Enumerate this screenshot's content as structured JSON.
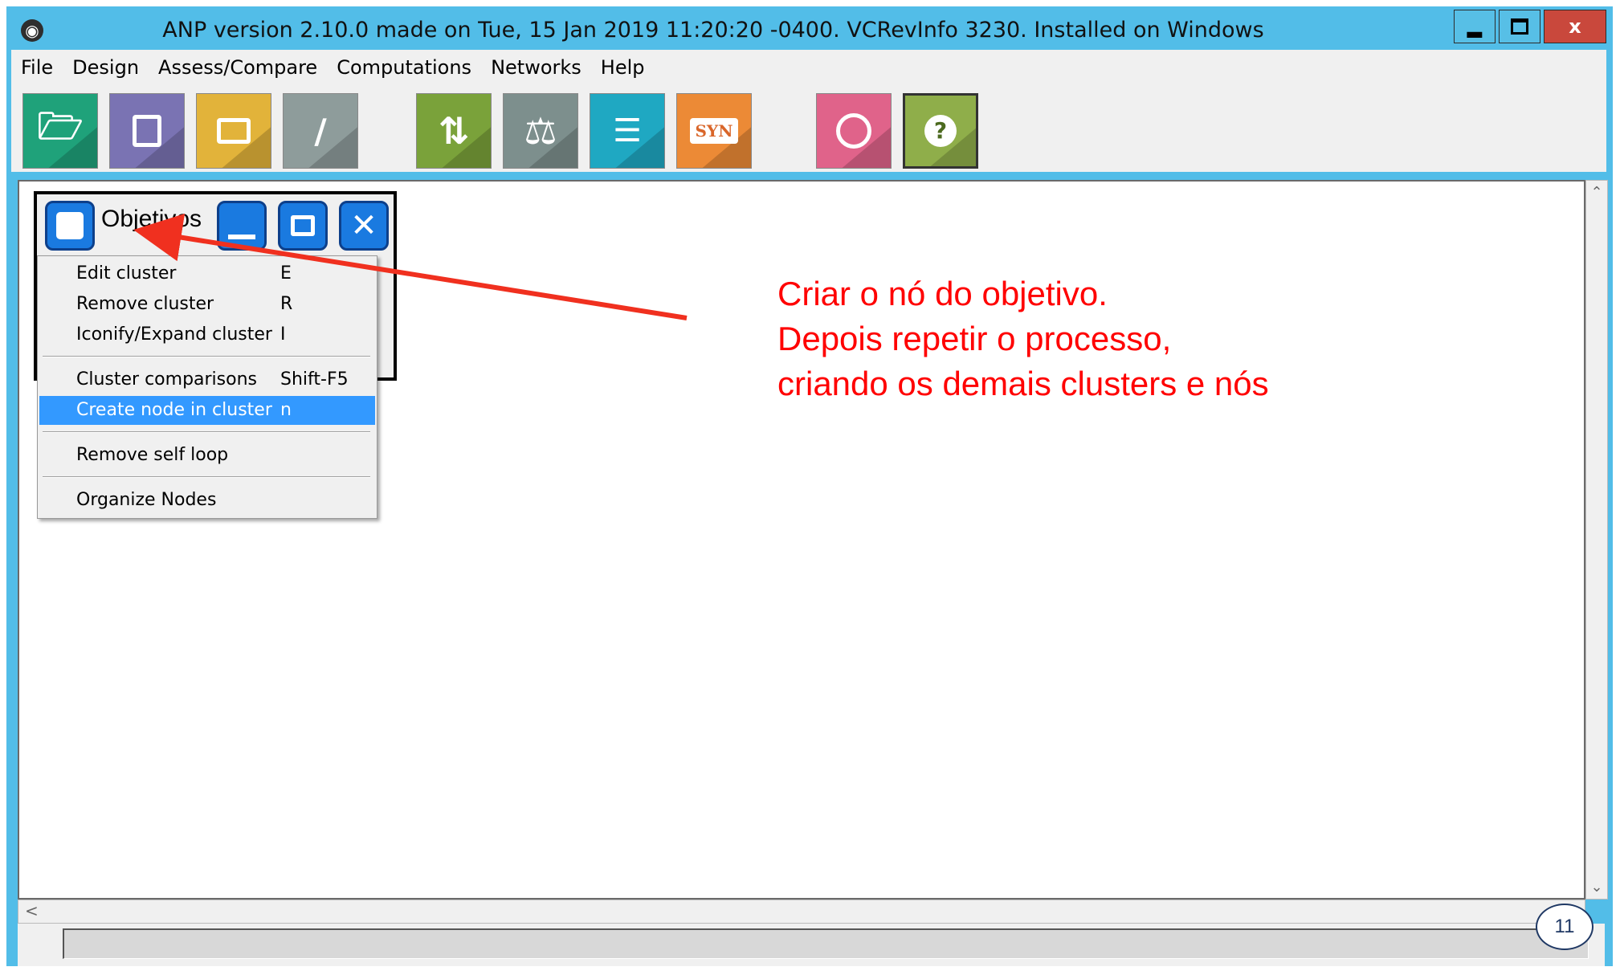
{
  "window": {
    "title": "ANP version 2.10.0 made on Tue, 15 Jan 2019 11:20:20 -0400.  VCRevInfo 3230.  Installed on Windows",
    "app_icon": "globe-icon",
    "controls": {
      "minimize": "minimize-icon",
      "maximize": "maximize-icon",
      "close_label": "x"
    }
  },
  "menubar": {
    "items": [
      {
        "label": "File"
      },
      {
        "label": "Design"
      },
      {
        "label": "Assess/Compare"
      },
      {
        "label": "Computations"
      },
      {
        "label": "Networks"
      },
      {
        "label": "Help"
      }
    ]
  },
  "toolbar": {
    "buttons": [
      {
        "icon": "open-folder-icon",
        "color": "#1fa27a"
      },
      {
        "icon": "save-icon",
        "color": "#7a73b3"
      },
      {
        "icon": "print-icon",
        "color": "#e2b33a"
      },
      {
        "icon": "paperclip-icon",
        "color": "#8e9c9b"
      },
      {
        "icon": "refresh-icon",
        "color": "#7aa23a"
      },
      {
        "icon": "balance-icon",
        "color": "#7d8f8d"
      },
      {
        "icon": "sliders-icon",
        "color": "#1fa8c2"
      },
      {
        "icon": "synthesis-icon",
        "color": "#ec8a36",
        "label": "SYN"
      },
      {
        "icon": "broadcast-icon",
        "color": "#e0638a"
      },
      {
        "icon": "help-icon",
        "color": "#8fae4a",
        "label": "?"
      }
    ]
  },
  "cluster": {
    "name": "Objetivos",
    "icons": [
      "cluster-icon",
      "minimize-icon",
      "maximize-icon",
      "close-icon"
    ]
  },
  "context_menu": {
    "groups": [
      [
        {
          "label": "Edit cluster",
          "key": "E"
        },
        {
          "label": "Remove cluster",
          "key": "R"
        },
        {
          "label": "Iconify/Expand cluster",
          "key": "I"
        }
      ],
      [
        {
          "label": "Cluster comparisons",
          "key": "Shift-F5"
        },
        {
          "label": "Create node in cluster",
          "key": "n",
          "selected": true
        }
      ],
      [
        {
          "label": "Remove self loop",
          "key": ""
        }
      ],
      [
        {
          "label": "Organize Nodes",
          "key": ""
        }
      ]
    ]
  },
  "annotation": {
    "lines": [
      "Criar o nó do objetivo.",
      "Depois repetir o processo,",
      "criando os demais clusters e nós"
    ],
    "color": "#ff0000"
  },
  "slide": {
    "page_number": "11"
  },
  "colors": {
    "window_frame": "#52bde8",
    "menu_selection": "#3399ff"
  }
}
